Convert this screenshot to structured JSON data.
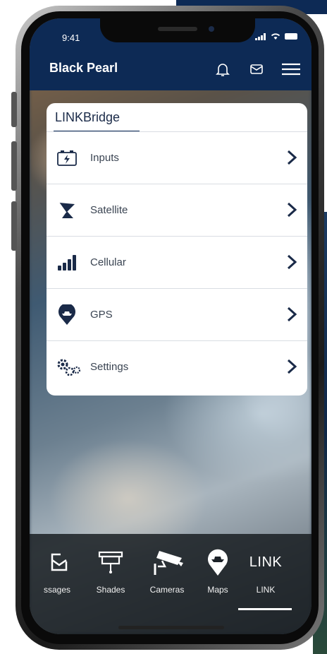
{
  "status_bar": {
    "time": "9:41"
  },
  "header": {
    "title": "Black Pearl"
  },
  "card": {
    "title": "LINKBridge",
    "items": [
      {
        "label": "Inputs",
        "icon": "battery-charge-icon"
      },
      {
        "label": "Satellite",
        "icon": "satellite-dish-icon"
      },
      {
        "label": "Cellular",
        "icon": "signal-bars-icon"
      },
      {
        "label": "GPS",
        "icon": "location-pin-boat-icon"
      },
      {
        "label": "Settings",
        "icon": "gears-icon"
      }
    ]
  },
  "tabs": [
    {
      "label": "ssages",
      "icon": "envelope-icon"
    },
    {
      "label": "Shades",
      "icon": "shade-icon"
    },
    {
      "label": "Cameras",
      "icon": "camera-icon"
    },
    {
      "label": "Maps",
      "icon": "map-pin-icon"
    },
    {
      "label": "LINK",
      "display": "LINK",
      "active": true
    }
  ],
  "colors": {
    "navy": "#0d2a55",
    "card_bg": "#ffffff",
    "bar_bg": "#141c1c"
  }
}
